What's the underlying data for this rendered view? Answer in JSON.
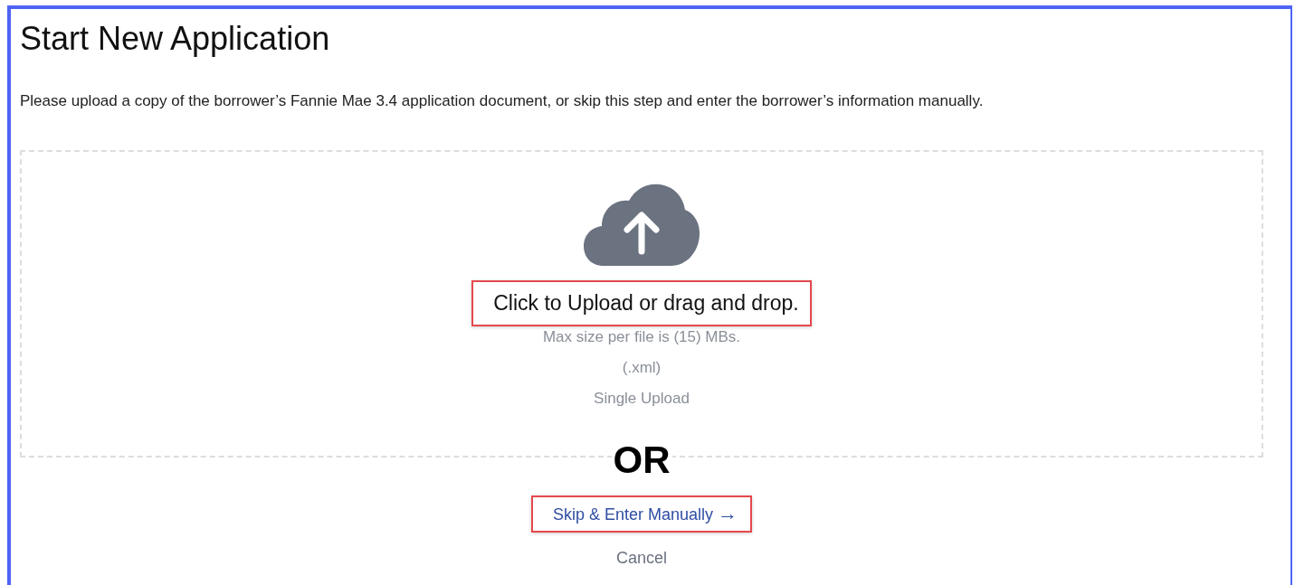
{
  "title": "Start New Application",
  "instructions": "Please upload a copy of the borrower’s Fannie Mae 3.4 application document, or skip this step and enter the borrower’s information manually.",
  "dropzone": {
    "prompt": "Click to Upload or drag and drop.",
    "prompt_highlighted": true,
    "notes": [
      "Max size per file is (15) MBs.",
      "(.xml)",
      "Single Upload"
    ]
  },
  "divider_text": "OR",
  "skip_link": {
    "label": "Skip & Enter Manually",
    "arrow": "→",
    "highlighted": true
  },
  "cancel": "Cancel"
}
